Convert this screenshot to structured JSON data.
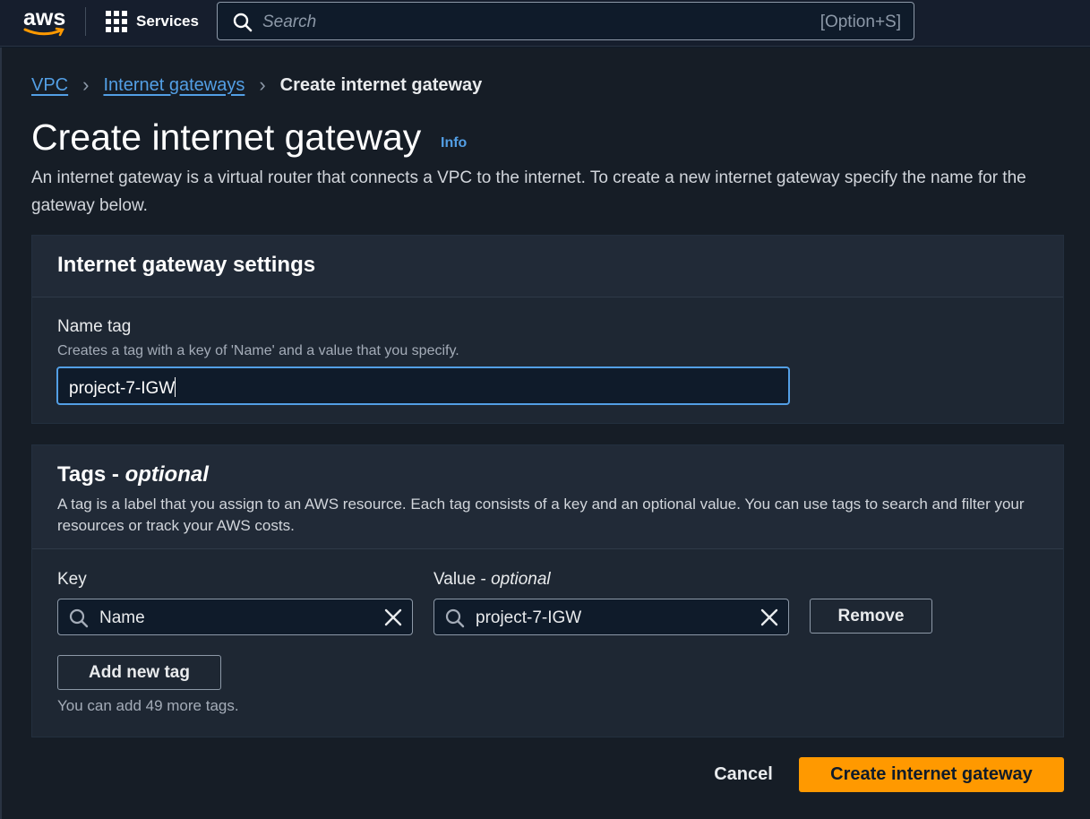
{
  "topbar": {
    "logo_text": "aws",
    "services_label": "Services",
    "search_placeholder": "Search",
    "search_shortcut": "[Option+S]"
  },
  "breadcrumb": {
    "items": [
      "VPC",
      "Internet gateways"
    ],
    "current": "Create internet gateway"
  },
  "page": {
    "title": "Create internet gateway",
    "info_label": "Info",
    "description": "An internet gateway is a virtual router that connects a VPC to the internet. To create a new internet gateway specify the name for the gateway below."
  },
  "settings": {
    "title": "Internet gateway settings",
    "name_tag_label": "Name tag",
    "name_tag_desc": "Creates a tag with a key of 'Name' and a value that you specify.",
    "name_tag_value": "project-7-IGW"
  },
  "tags": {
    "title": "Tags - ",
    "title_optional": "optional",
    "description": "A tag is a label that you assign to an AWS resource. Each tag consists of a key and an optional value. You can use tags to search and filter your resources or track your AWS costs.",
    "key_label": "Key",
    "value_label": "Value - ",
    "value_label_optional": "optional",
    "rows": [
      {
        "key": "Name",
        "value": "project-7-IGW"
      }
    ],
    "remove_label": "Remove",
    "add_label": "Add new tag",
    "helper": "You can add 49 more tags."
  },
  "footer": {
    "cancel_label": "Cancel",
    "create_label": "Create internet gateway"
  },
  "colors": {
    "accent": "#ff9900",
    "link": "#539fe5",
    "background": "#161d26"
  }
}
